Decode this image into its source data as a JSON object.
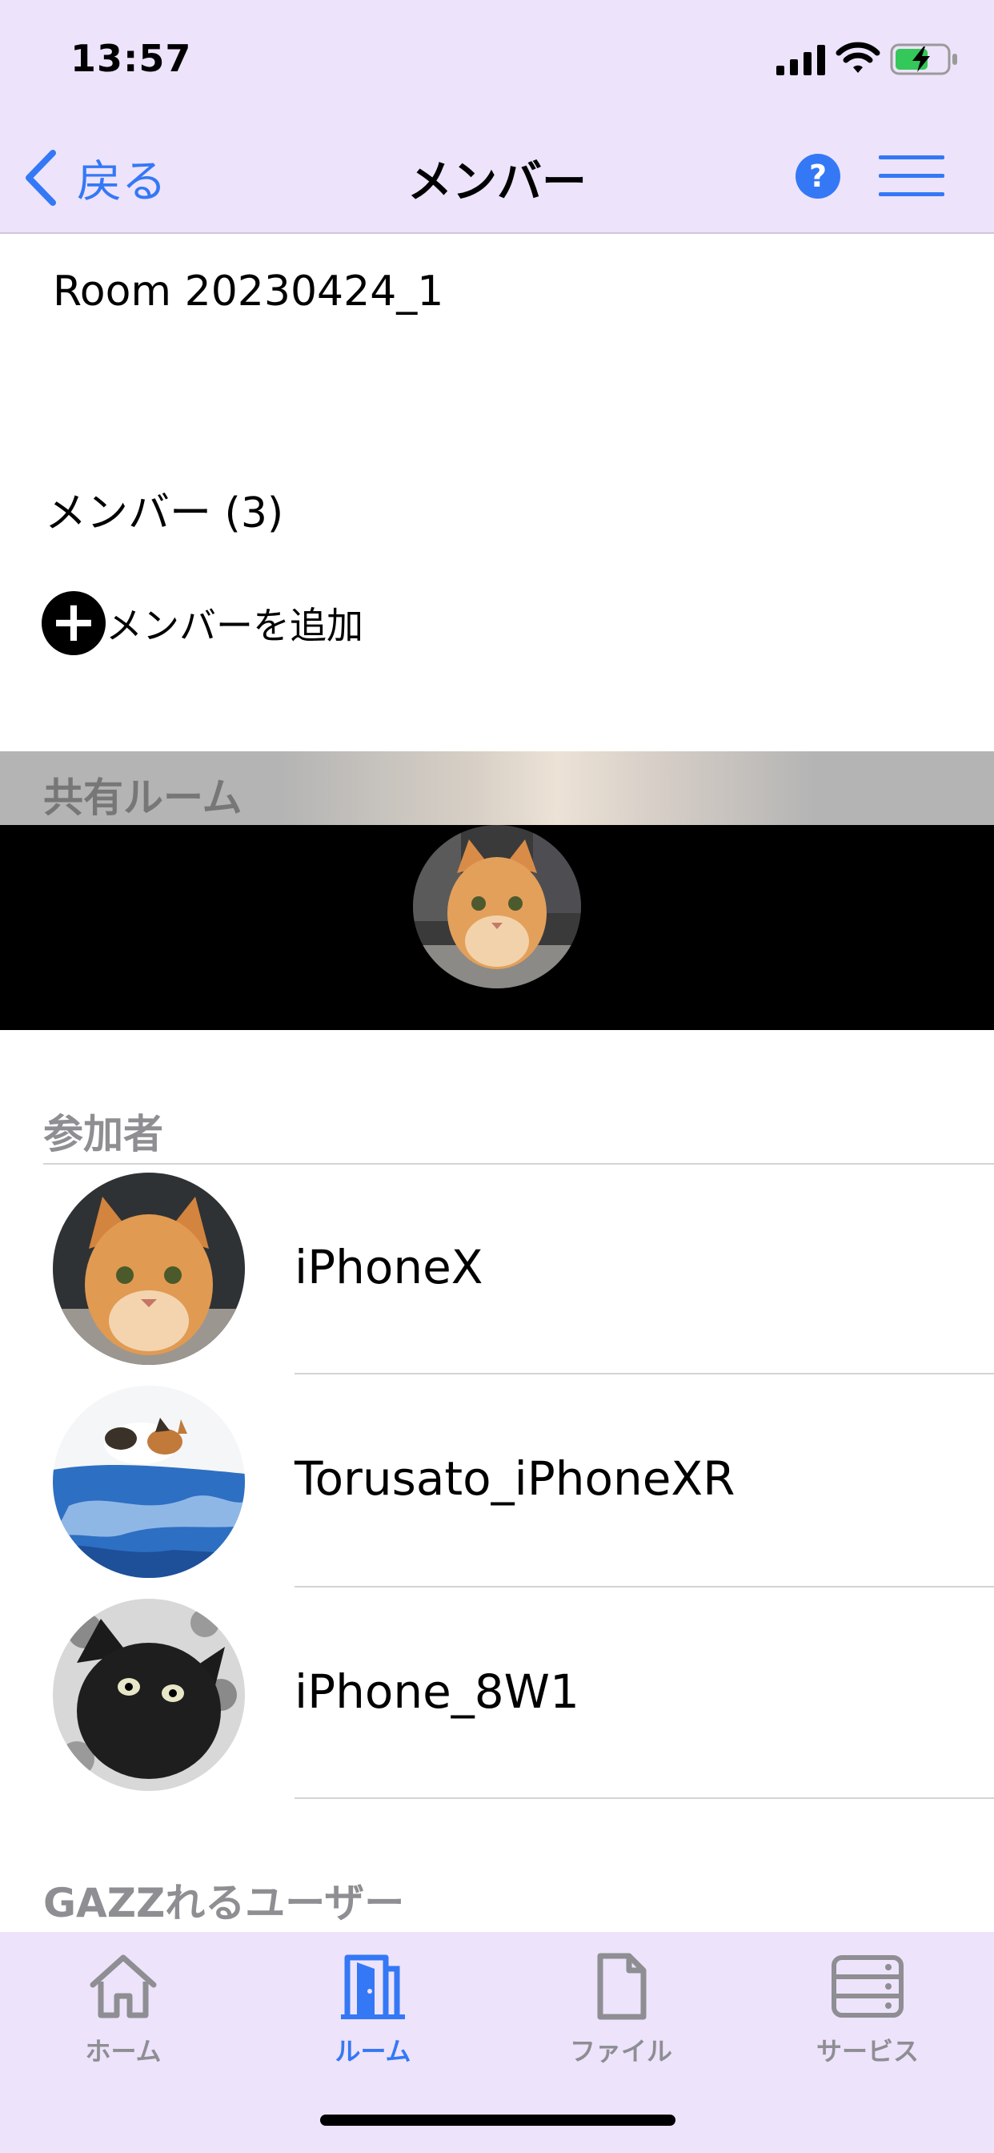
{
  "status": {
    "time": "13:57"
  },
  "nav": {
    "back_label": "戻る",
    "title": "メンバー",
    "help_label": "?"
  },
  "room": {
    "name": "Room 20230424_1"
  },
  "members": {
    "count_label": "メンバー (3)",
    "add_icon": "+",
    "add_label": "メンバーを追加"
  },
  "shared": {
    "header": "共有ルーム"
  },
  "participants": {
    "header": "参加者",
    "items": [
      {
        "name": "iPhoneX"
      },
      {
        "name": "Torusato_iPhoneXR"
      },
      {
        "name": "iPhone_8W1"
      }
    ]
  },
  "gazz": {
    "header": "GAZZれるユーザー"
  },
  "tabs": [
    {
      "label": "ホーム",
      "icon": "house-icon"
    },
    {
      "label": "ルーム",
      "icon": "door-icon",
      "active": true
    },
    {
      "label": "ファイル",
      "icon": "document-icon"
    },
    {
      "label": "サービス",
      "icon": "server-icon"
    }
  ],
  "colors": {
    "accent": "#3478f6",
    "bar_bg": "#ede3fb",
    "section_text": "#8e8e93"
  }
}
